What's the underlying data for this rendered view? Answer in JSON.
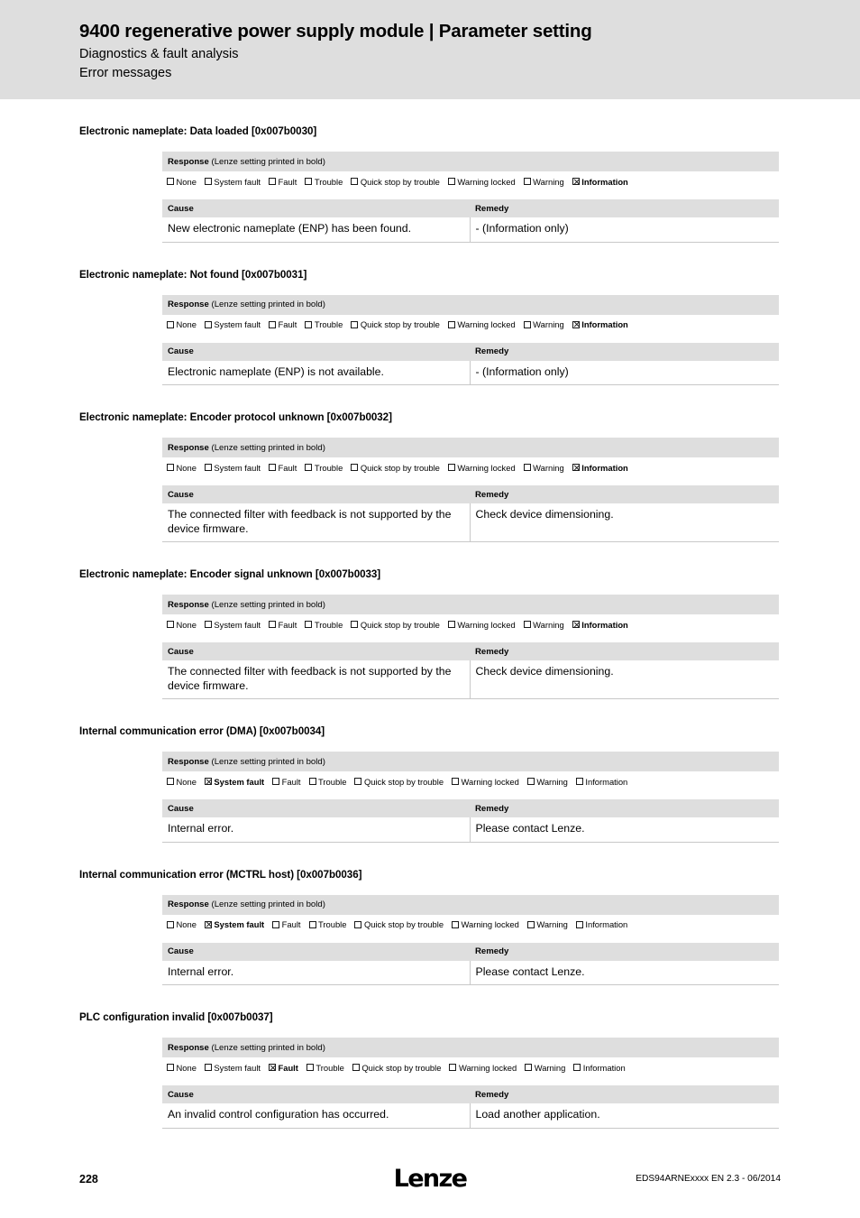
{
  "header": {
    "title": "9400 regenerative power supply module | Parameter setting",
    "subtitle1": "Diagnostics & fault analysis",
    "subtitle2": "Error messages"
  },
  "labels": {
    "response_label": "Response",
    "response_note": " (Lenze setting printed in bold)",
    "cause_header": "Cause",
    "remedy_header": "Remedy"
  },
  "response_options": [
    "None",
    "System fault",
    "Fault",
    "Trouble",
    "Quick stop by trouble",
    "Warning locked",
    "Warning",
    "Information"
  ],
  "sections": [
    {
      "title": "Electronic nameplate: Data loaded [0x007b0030]",
      "checked": "Information",
      "cause": "New electronic nameplate (ENP) has been found.",
      "remedy": "- (Information only)"
    },
    {
      "title": "Electronic nameplate: Not found [0x007b0031]",
      "checked": "Information",
      "cause": "Electronic nameplate (ENP) is not available.",
      "remedy": "- (Information only)"
    },
    {
      "title": "Electronic nameplate: Encoder protocol unknown [0x007b0032]",
      "checked": "Information",
      "cause": "The connected filter with feedback is not supported by the device firmware.",
      "remedy": "Check device dimensioning."
    },
    {
      "title": "Electronic nameplate: Encoder signal unknown [0x007b0033]",
      "checked": "Information",
      "cause": "The connected filter with feedback is not supported by the device firmware.",
      "remedy": "Check device dimensioning."
    },
    {
      "title": "Internal communication error (DMA) [0x007b0034]",
      "checked": "System fault",
      "cause": "Internal error.",
      "remedy": "Please contact Lenze."
    },
    {
      "title": "Internal communication error (MCTRL host) [0x007b0036]",
      "checked": "System fault",
      "cause": "Internal error.",
      "remedy": "Please contact Lenze."
    },
    {
      "title": "PLC configuration invalid [0x007b0037]",
      "checked": "Fault",
      "cause": "An invalid control configuration has occurred.",
      "remedy": "Load another application."
    }
  ],
  "footer": {
    "page_number": "228",
    "logo_text": "Lenze",
    "doc_reference": "EDS94ARNExxxx EN 2.3 - 06/2014"
  },
  "colors": {
    "band_gray": "#dedede",
    "rule_gray": "#c8c8c8"
  }
}
